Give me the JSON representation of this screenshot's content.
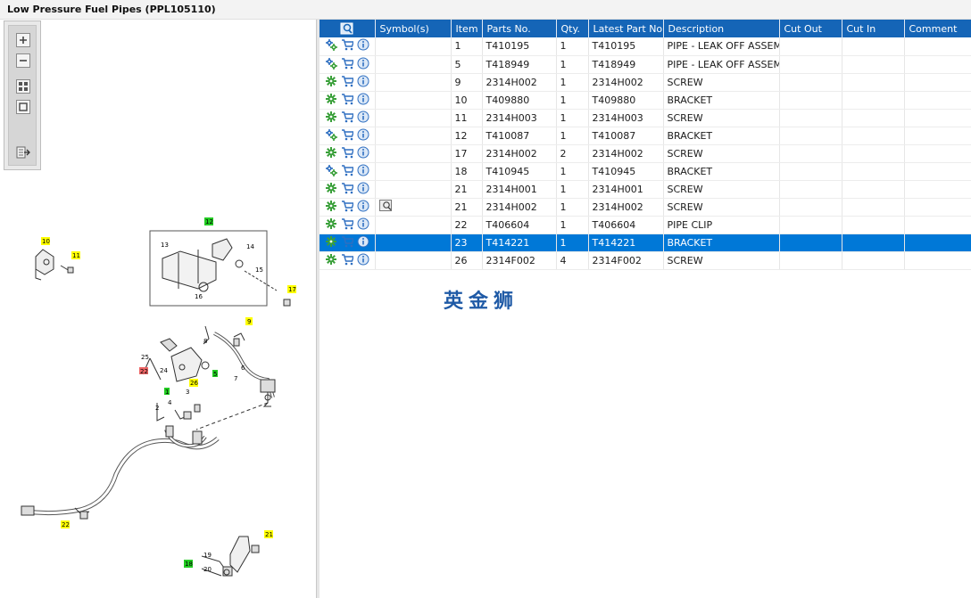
{
  "window": {
    "title": "Low Pressure Fuel Pipes (PPL105110)"
  },
  "toolbar": {
    "buttons": [
      {
        "name": "zoom-in",
        "icon": "zoom-in-icon"
      },
      {
        "name": "zoom-out",
        "icon": "zoom-out-icon"
      },
      {
        "name": "fit-all",
        "icon": "fit-all-icon"
      },
      {
        "name": "actual-size",
        "icon": "actual-size-icon"
      },
      {
        "name": "export",
        "icon": "export-list-icon"
      }
    ]
  },
  "diagram": {
    "callouts": [
      "10",
      "11",
      "13",
      "14",
      "15",
      "16",
      "12",
      "17",
      "9",
      "25",
      "24",
      "22",
      "8",
      "6",
      "7",
      "26",
      "5",
      "2",
      "4",
      "3",
      "22",
      "21",
      "19",
      "20",
      "18",
      "1",
      "1"
    ],
    "highlight_colors": {
      "yellow": "#ffff00",
      "green": "#22cc22",
      "red": "#ee6666"
    }
  },
  "table": {
    "columns": [
      "",
      "Symbol(s)",
      "Item",
      "Parts No.",
      "Qty.",
      "Latest Part No.",
      "Description",
      "Cut Out",
      "Cut In",
      "Comment"
    ],
    "rows": [
      {
        "icon_type": "group",
        "symbol": "",
        "item": "1",
        "part_no": "T410195",
        "qty": "1",
        "latest": "T410195",
        "desc": "PIPE - LEAK OFF ASSEMBL",
        "cut_out": "",
        "cut_in": "",
        "comment": ""
      },
      {
        "icon_type": "group",
        "symbol": "",
        "item": "5",
        "part_no": "T418949",
        "qty": "1",
        "latest": "T418949",
        "desc": "PIPE - LEAK OFF ASSEMBL",
        "cut_out": "",
        "cut_in": "",
        "comment": ""
      },
      {
        "icon_type": "gear",
        "symbol": "",
        "item": "9",
        "part_no": "2314H002",
        "qty": "1",
        "latest": "2314H002",
        "desc": "SCREW",
        "cut_out": "",
        "cut_in": "",
        "comment": ""
      },
      {
        "icon_type": "gear",
        "symbol": "",
        "item": "10",
        "part_no": "T409880",
        "qty": "1",
        "latest": "T409880",
        "desc": "BRACKET",
        "cut_out": "",
        "cut_in": "",
        "comment": ""
      },
      {
        "icon_type": "gear",
        "symbol": "",
        "item": "11",
        "part_no": "2314H003",
        "qty": "1",
        "latest": "2314H003",
        "desc": "SCREW",
        "cut_out": "",
        "cut_in": "",
        "comment": ""
      },
      {
        "icon_type": "group",
        "symbol": "",
        "item": "12",
        "part_no": "T410087",
        "qty": "1",
        "latest": "T410087",
        "desc": "BRACKET",
        "cut_out": "",
        "cut_in": "",
        "comment": ""
      },
      {
        "icon_type": "gear",
        "symbol": "",
        "item": "17",
        "part_no": "2314H002",
        "qty": "2",
        "latest": "2314H002",
        "desc": "SCREW",
        "cut_out": "",
        "cut_in": "",
        "comment": ""
      },
      {
        "icon_type": "group",
        "symbol": "",
        "item": "18",
        "part_no": "T410945",
        "qty": "1",
        "latest": "T410945",
        "desc": "BRACKET",
        "cut_out": "",
        "cut_in": "",
        "comment": ""
      },
      {
        "icon_type": "gear",
        "symbol": "",
        "item": "21",
        "part_no": "2314H001",
        "qty": "1",
        "latest": "2314H001",
        "desc": "SCREW",
        "cut_out": "",
        "cut_in": "",
        "comment": ""
      },
      {
        "icon_type": "gear",
        "symbol": "magnifier",
        "item": "21",
        "part_no": "2314H002",
        "qty": "1",
        "latest": "2314H002",
        "desc": "SCREW",
        "cut_out": "",
        "cut_in": "",
        "comment": ""
      },
      {
        "icon_type": "gear",
        "symbol": "",
        "item": "22",
        "part_no": "T406604",
        "qty": "1",
        "latest": "T406604",
        "desc": "PIPE CLIP",
        "cut_out": "",
        "cut_in": "",
        "comment": ""
      },
      {
        "icon_type": "gear",
        "symbol": "",
        "item": "23",
        "part_no": "T414221",
        "qty": "1",
        "latest": "T414221",
        "desc": "BRACKET",
        "cut_out": "",
        "cut_in": "",
        "comment": "",
        "selected": true
      },
      {
        "icon_type": "gear",
        "symbol": "",
        "item": "26",
        "part_no": "2314F002",
        "qty": "4",
        "latest": "2314F002",
        "desc": "SCREW",
        "cut_out": "",
        "cut_in": "",
        "comment": ""
      }
    ]
  },
  "watermark": "英金狮"
}
